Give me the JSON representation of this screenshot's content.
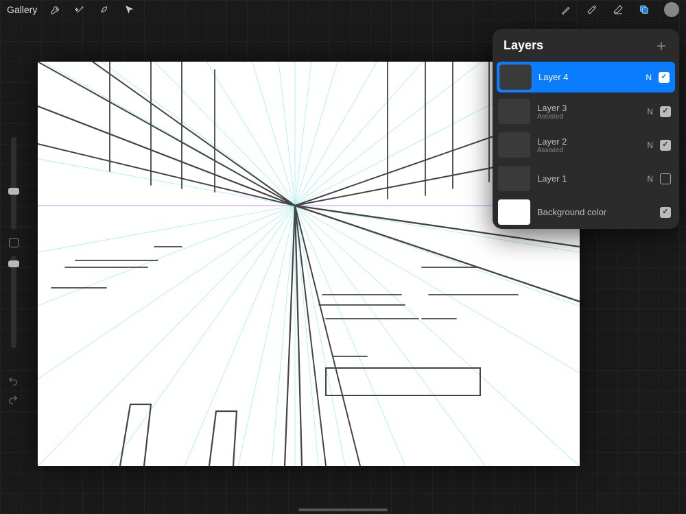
{
  "topbar": {
    "gallery_label": "Gallery"
  },
  "panel": {
    "title": "Layers"
  },
  "layers": [
    {
      "name": "Layer 4",
      "sub": "",
      "blend": "N",
      "visible": true,
      "selected": true,
      "thumb": "dark"
    },
    {
      "name": "Layer 3",
      "sub": "Assisted",
      "blend": "N",
      "visible": true,
      "selected": false,
      "thumb": "dark"
    },
    {
      "name": "Layer 2",
      "sub": "Assisted",
      "blend": "N",
      "visible": true,
      "selected": false,
      "thumb": "dark"
    },
    {
      "name": "Layer 1",
      "sub": "",
      "blend": "N",
      "visible": false,
      "selected": false,
      "thumb": "dark"
    },
    {
      "name": "Background color",
      "sub": "",
      "blend": "",
      "visible": true,
      "selected": false,
      "thumb": "white"
    }
  ],
  "colors": {
    "accent": "#0a84ff",
    "brush_color": "#888888"
  },
  "sliders": {
    "brush_size_pos_pct": 55,
    "brush_opacity_pos_pct": 5
  }
}
